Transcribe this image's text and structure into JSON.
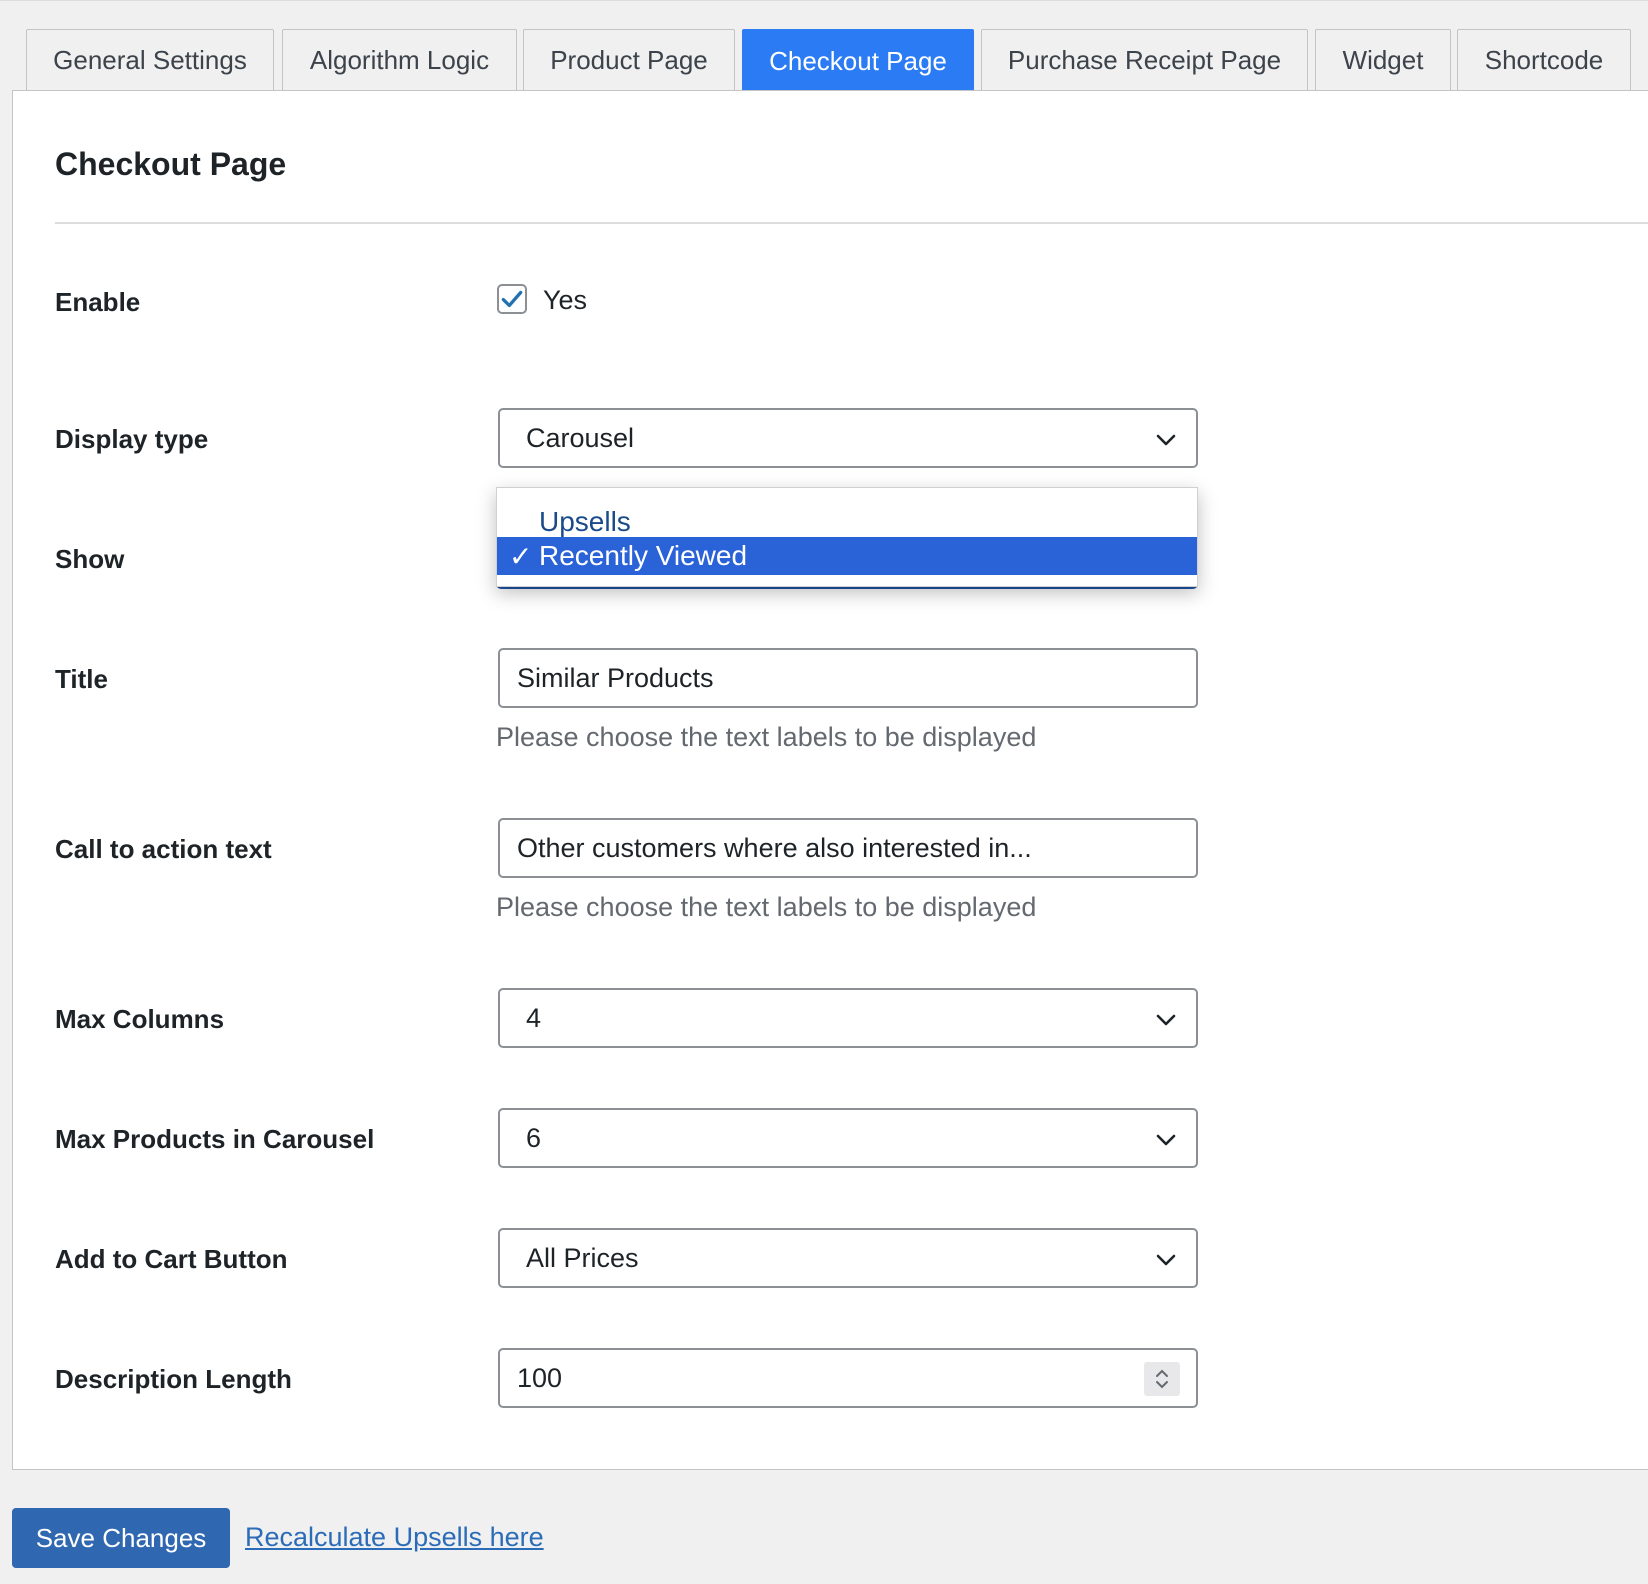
{
  "tabs": [
    {
      "label": "General Settings",
      "active": false
    },
    {
      "label": "Algorithm Logic",
      "active": false
    },
    {
      "label": "Product Page",
      "active": false
    },
    {
      "label": "Checkout Page",
      "active": true
    },
    {
      "label": "Purchase Receipt Page",
      "active": false
    },
    {
      "label": "Widget",
      "active": false
    },
    {
      "label": "Shortcode",
      "active": false
    }
  ],
  "section": {
    "title": "Checkout Page"
  },
  "fields": {
    "enable": {
      "label": "Enable",
      "checked": true,
      "option_label": "Yes"
    },
    "display_type": {
      "label": "Display type",
      "value": "Carousel"
    },
    "show": {
      "label": "Show",
      "options": [
        {
          "label": "Upsells",
          "selected": false
        },
        {
          "label": "Recently Viewed",
          "selected": true
        }
      ],
      "selected_mark": "✓"
    },
    "title": {
      "label": "Title",
      "value": "Similar Products",
      "help": "Please choose the text labels to be displayed"
    },
    "cta": {
      "label": "Call to action text",
      "value": "Other customers where also interested in...",
      "help": "Please choose the text labels to be displayed"
    },
    "max_columns": {
      "label": "Max Columns",
      "value": "4"
    },
    "max_products": {
      "label": "Max Products in Carousel",
      "value": "6"
    },
    "add_to_cart": {
      "label": "Add to Cart Button",
      "value": "All Prices"
    },
    "description_length": {
      "label": "Description Length",
      "value": "100"
    }
  },
  "footer": {
    "save_label": "Save Changes",
    "recalc_link": "Recalculate Upsells here"
  },
  "colors": {
    "accent": "#2b7bf5",
    "button": "#2f67b1",
    "selected_option": "#2a62d8"
  }
}
